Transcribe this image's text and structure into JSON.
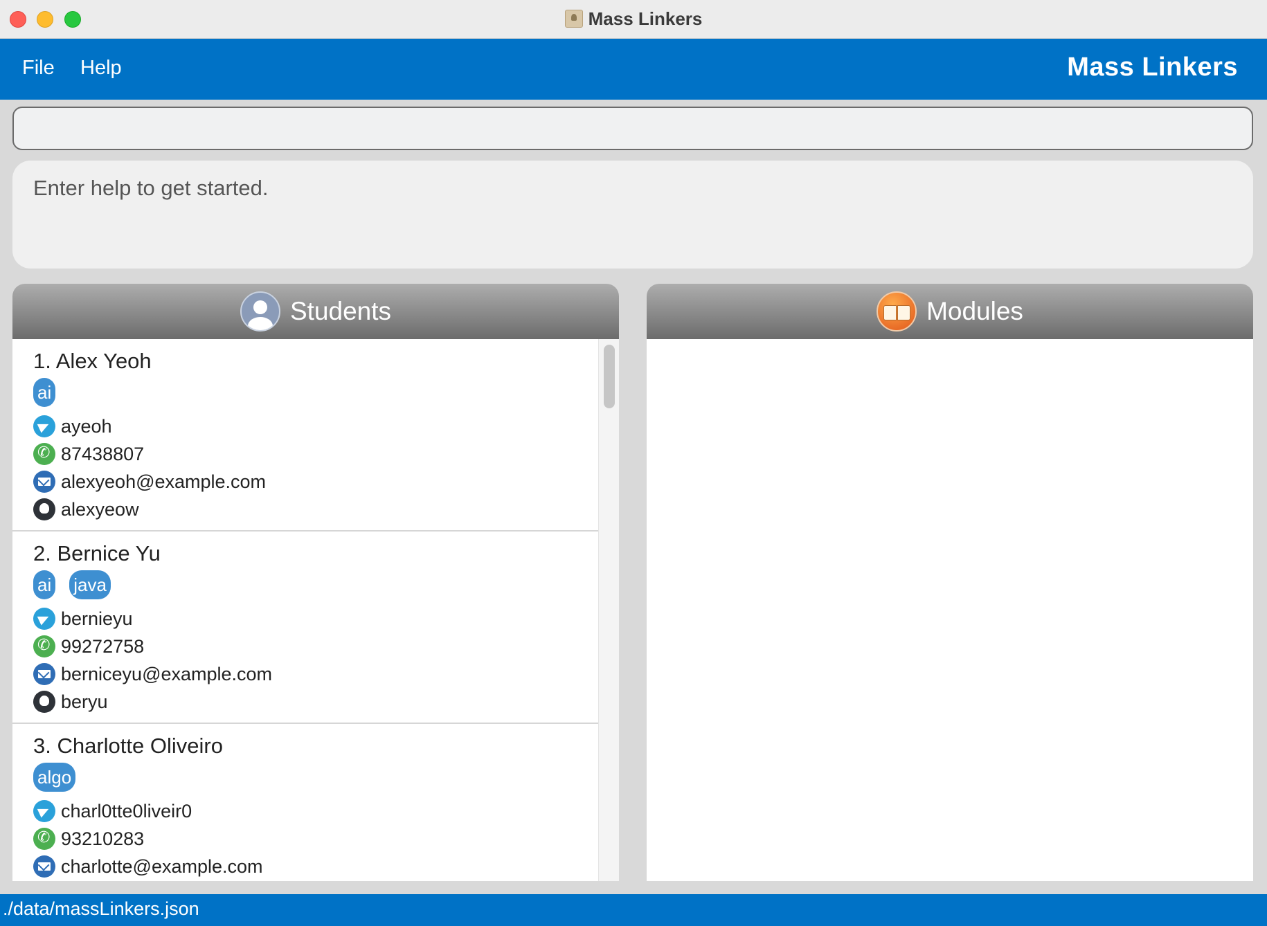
{
  "window": {
    "title": "Mass Linkers"
  },
  "menu": {
    "file": "File",
    "help": "Help",
    "brand": "Mass Linkers"
  },
  "command": {
    "value": "",
    "placeholder": ""
  },
  "result": {
    "text": "Enter help to get started."
  },
  "students_panel": {
    "title": "Students",
    "icon": "person-icon"
  },
  "modules_panel": {
    "title": "Modules",
    "icon": "book-icon",
    "items": []
  },
  "students": [
    {
      "name": "1. Alex Yeoh",
      "tags": [
        "ai"
      ],
      "telegram": "ayeoh",
      "phone": "87438807",
      "email": "alexyeoh@example.com",
      "github": "alexyeow"
    },
    {
      "name": "2. Bernice Yu",
      "tags": [
        "ai",
        "java"
      ],
      "telegram": "bernieyu",
      "phone": "99272758",
      "email": "berniceyu@example.com",
      "github": "beryu"
    },
    {
      "name": "3. Charlotte Oliveiro",
      "tags": [
        "algo"
      ],
      "telegram": "charl0tte0liveir0",
      "phone": "93210283",
      "email": "charlotte@example.com"
    }
  ],
  "status": {
    "path": "./data/massLinkers.json"
  },
  "colors": {
    "accent": "#0072c6",
    "tag": "#3e8fd1",
    "telegram": "#2aa1da",
    "phone": "#4caf50",
    "email": "#2f6db5",
    "github": "#2e3238"
  }
}
